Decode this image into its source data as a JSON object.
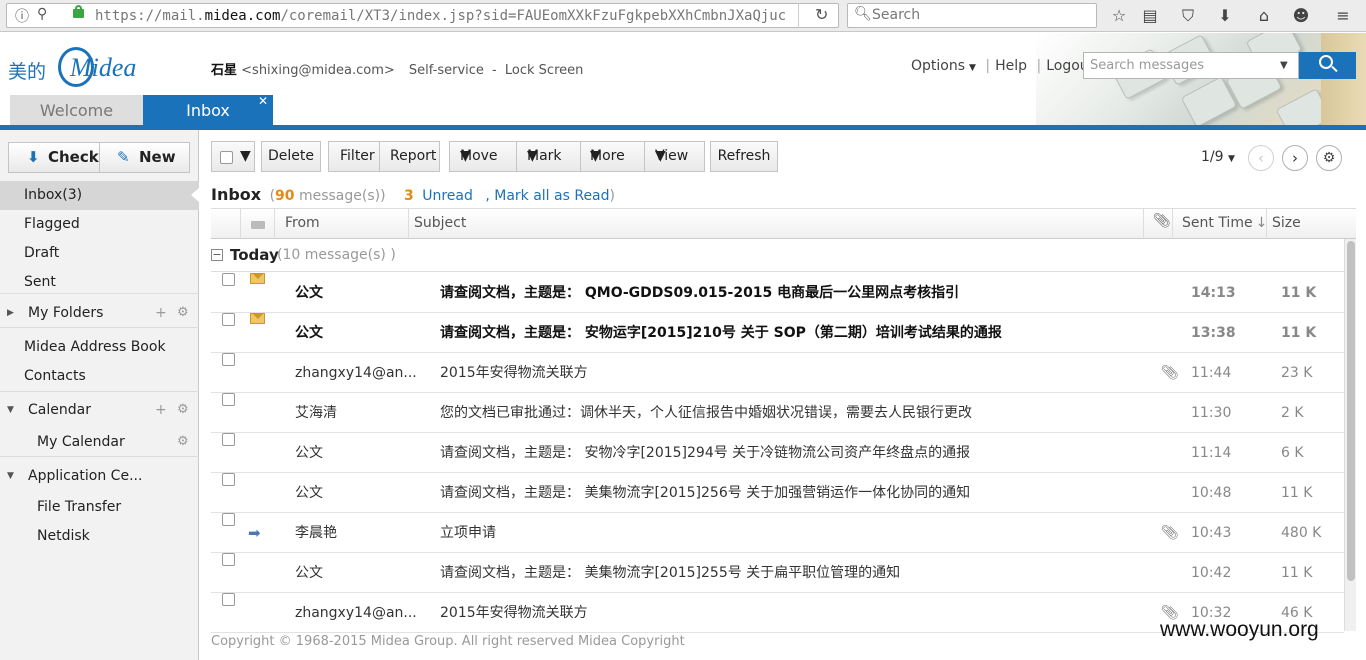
{
  "browser": {
    "url_prefix": "https://mail.",
    "url_domain": "midea.com",
    "url_suffix": "/coremail/XT3/index.jsp?sid=FAUEomXXkFzuFgkpebXXhCmbnJXaQjuc",
    "search_placeholder": "Search"
  },
  "header": {
    "logo_cn": "美的",
    "logo_en": "Midea",
    "user_name": "石星",
    "user_email": "<shixing@midea.com>",
    "self_service": "Self-service",
    "dash": "-",
    "lock_screen": "Lock Screen",
    "options": "Options",
    "help": "Help",
    "logout": "Logout",
    "search_placeholder": "Search messages"
  },
  "tabs": {
    "welcome": "Welcome",
    "inbox": "Inbox"
  },
  "sidebar": {
    "check": "Check",
    "new": "New",
    "items": [
      {
        "label": "Inbox(3)"
      },
      {
        "label": "Flagged"
      },
      {
        "label": "Draft"
      },
      {
        "label": "Sent"
      },
      {
        "label": "My Folders"
      },
      {
        "label": "Midea Address Book"
      },
      {
        "label": "Contacts"
      },
      {
        "label": "Calendar"
      },
      {
        "label": "My Calendar"
      },
      {
        "label": "Application Ce..."
      },
      {
        "label": "File Transfer"
      },
      {
        "label": "Netdisk"
      }
    ]
  },
  "toolbar": {
    "delete": "Delete",
    "filter": "Filter",
    "report": "Report",
    "move": "Move",
    "mark": "Mark",
    "more": "More",
    "view": "View",
    "refresh": "Refresh",
    "page": "1/9"
  },
  "summary": {
    "title": "Inbox",
    "count": "90",
    "count_label": "message(s)",
    "unread_count": "3",
    "unread_label": "Unread",
    "mark_all": ", Mark all as Read"
  },
  "columns": {
    "from": "From",
    "subject": "Subject",
    "sent_time": "Sent Time",
    "size": "Size"
  },
  "group": {
    "title": "Today",
    "count": "(10 message(s) )"
  },
  "messages": [
    {
      "from": "公文",
      "subject": "请查阅文档，主题是： QMO-GDDS09.015-2015 电商最后一公里网点考核指引",
      "time": "14:13",
      "size": "11 K",
      "unread": true,
      "attach": false,
      "icon": "envelope"
    },
    {
      "from": "公文",
      "subject": "请查阅文档，主题是： 安物运字[2015]210号 关于 SOP（第二期）培训考试结果的通报",
      "time": "13:38",
      "size": "11 K",
      "unread": true,
      "attach": false,
      "icon": "envelope"
    },
    {
      "from": "zhangxy14@an...",
      "subject": "2015年安得物流关联方",
      "time": "11:44",
      "size": "23 K",
      "unread": false,
      "attach": true,
      "icon": ""
    },
    {
      "from": "艾海清",
      "subject": "您的文档已审批通过：调休半天，个人征信报告中婚姻状况错误，需要去人民银行更改",
      "time": "11:30",
      "size": "2 K",
      "unread": false,
      "attach": false,
      "icon": ""
    },
    {
      "from": "公文",
      "subject": "请查阅文档，主题是： 安物冷字[2015]294号 关于冷链物流公司资产年终盘点的通报",
      "time": "11:14",
      "size": "6 K",
      "unread": false,
      "attach": false,
      "icon": ""
    },
    {
      "from": "公文",
      "subject": "请查阅文档，主题是： 美集物流字[2015]256号 关于加强营销运作一体化协同的通知",
      "time": "10:48",
      "size": "11 K",
      "unread": false,
      "attach": false,
      "icon": ""
    },
    {
      "from": "李晨艳",
      "subject": "立项申请",
      "time": "10:43",
      "size": "480 K",
      "unread": false,
      "attach": true,
      "icon": "forward"
    },
    {
      "from": "公文",
      "subject": "请查阅文档，主题是： 美集物流字[2015]255号 关于扁平职位管理的通知",
      "time": "10:42",
      "size": "11 K",
      "unread": false,
      "attach": false,
      "icon": ""
    },
    {
      "from": "zhangxy14@an...",
      "subject": "2015年安得物流关联方",
      "time": "10:32",
      "size": "46 K",
      "unread": false,
      "attach": true,
      "icon": ""
    }
  ],
  "footer": {
    "copyright": "Copyright © 1968-2015 Midea Group. All right reserved Midea Copyright",
    "watermark": "www.wooyun.org"
  }
}
